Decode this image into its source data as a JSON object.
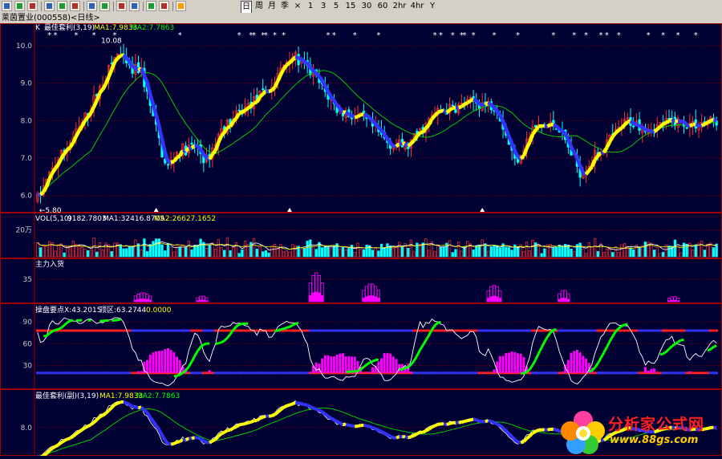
{
  "toolbar": {
    "icons": [
      "candlestick-icon",
      "line-chart-icon",
      "bar-chart-icon",
      "refresh-icon",
      "zoom-icon",
      "search-icon",
      "draw-icon",
      "flag-icon",
      "grid-icon",
      "layout-icon",
      "edit-icon",
      "tools-icon",
      "lightning-icon"
    ],
    "periods": [
      "日",
      "周",
      "月",
      "季",
      "×",
      "1",
      "3",
      "5",
      "15",
      "30",
      "60",
      "2hr",
      "4hr",
      "Y"
    ],
    "selected_period": "日"
  },
  "window_title": "莱茵置业(000558)<日线>",
  "chart_data": [
    {
      "id": "price",
      "type": "candlestick",
      "title": "K",
      "indicator_label": "最佳套利(3,19)",
      "ma1_label": "MA1:7.9833",
      "ma2_label": "MA2:7.7863",
      "ylim": [
        5.8,
        10.3
      ],
      "yticks": [
        "10.0",
        "9.0",
        "8.0",
        "7.0",
        "6.0"
      ],
      "ytick_values": [
        10,
        9,
        8,
        7,
        6
      ],
      "high_label": "10.08",
      "low_label": "5.80",
      "start_price": 5.9,
      "bar_count": 230,
      "colors": {
        "up": "#ff3030",
        "down": "#00ffff",
        "ma1": "#ffff00",
        "ma1_down": "#3333ff",
        "ma2": "#00cc00",
        "grid": "#a00000"
      }
    },
    {
      "id": "volume",
      "type": "bar",
      "title": "VOL(5,10)",
      "value_label": "9182.7803",
      "ma1_label": "MA1:32416.8705",
      "ma2_label": "MA2:26627.1652",
      "yticks": [
        "20万"
      ],
      "ylim": [
        0,
        300000
      ],
      "colors": {
        "up": "#ff3030",
        "down": "#00ffff",
        "ma1": "#ffffff",
        "ma2": "#ffff00"
      }
    },
    {
      "id": "main-force",
      "type": "bar",
      "title": "主力入货",
      "yticks": [
        "35"
      ],
      "ylim": [
        0,
        60
      ],
      "colors": {
        "bar": "#ff00ff"
      }
    },
    {
      "id": "trader-point",
      "type": "line",
      "title": "操盘要点",
      "x_label": "X:43.2015",
      "top_label": "顶区:63.2744",
      "zero_label": "0.0000",
      "ylim": [
        0,
        100
      ],
      "yticks": [
        "90",
        "60",
        "30"
      ],
      "ytick_values": [
        90,
        60,
        30
      ],
      "colors": {
        "line": "#ffffff",
        "bar": "#ff00ff",
        "band": "#00ff00",
        "high": "#ff2020",
        "low": "#3333ff"
      }
    },
    {
      "id": "arbitrage-sub",
      "type": "line",
      "title": "最佳套利(副)(3,19)",
      "ma1_label": "MA1:7.9833",
      "ma2_label": "MA2:7.7863",
      "yticks": [
        "8.0"
      ],
      "ytick_values": [
        8
      ],
      "colors": {
        "ma1": "#ffff00",
        "ma1_down": "#3333ff",
        "ma2": "#00cc00",
        "line": "#ffffff"
      }
    }
  ],
  "logo": {
    "text": "分析家公式网",
    "url": "www.88gs.com"
  }
}
